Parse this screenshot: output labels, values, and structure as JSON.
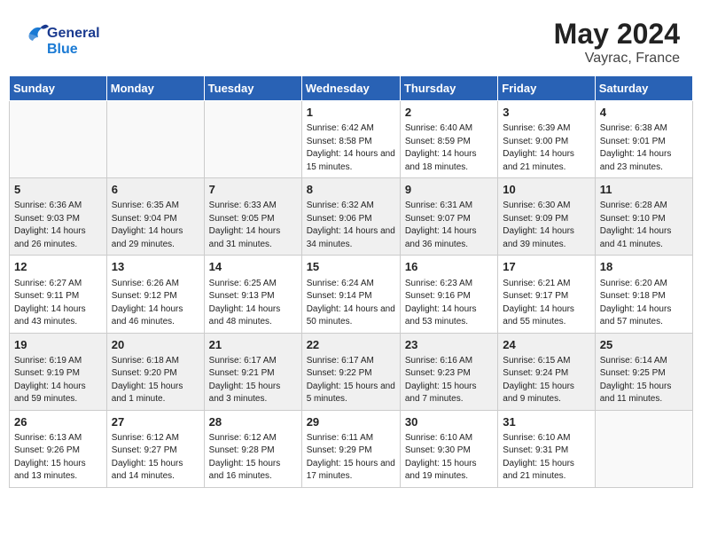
{
  "header": {
    "logo_general": "General",
    "logo_blue": "Blue",
    "month_year": "May 2024",
    "location": "Vayrac, France"
  },
  "days_of_week": [
    "Sunday",
    "Monday",
    "Tuesday",
    "Wednesday",
    "Thursday",
    "Friday",
    "Saturday"
  ],
  "weeks": [
    [
      {
        "day": "",
        "sunrise": "",
        "sunset": "",
        "daylight": ""
      },
      {
        "day": "",
        "sunrise": "",
        "sunset": "",
        "daylight": ""
      },
      {
        "day": "",
        "sunrise": "",
        "sunset": "",
        "daylight": ""
      },
      {
        "day": "1",
        "sunrise": "Sunrise: 6:42 AM",
        "sunset": "Sunset: 8:58 PM",
        "daylight": "Daylight: 14 hours and 15 minutes."
      },
      {
        "day": "2",
        "sunrise": "Sunrise: 6:40 AM",
        "sunset": "Sunset: 8:59 PM",
        "daylight": "Daylight: 14 hours and 18 minutes."
      },
      {
        "day": "3",
        "sunrise": "Sunrise: 6:39 AM",
        "sunset": "Sunset: 9:00 PM",
        "daylight": "Daylight: 14 hours and 21 minutes."
      },
      {
        "day": "4",
        "sunrise": "Sunrise: 6:38 AM",
        "sunset": "Sunset: 9:01 PM",
        "daylight": "Daylight: 14 hours and 23 minutes."
      }
    ],
    [
      {
        "day": "5",
        "sunrise": "Sunrise: 6:36 AM",
        "sunset": "Sunset: 9:03 PM",
        "daylight": "Daylight: 14 hours and 26 minutes."
      },
      {
        "day": "6",
        "sunrise": "Sunrise: 6:35 AM",
        "sunset": "Sunset: 9:04 PM",
        "daylight": "Daylight: 14 hours and 29 minutes."
      },
      {
        "day": "7",
        "sunrise": "Sunrise: 6:33 AM",
        "sunset": "Sunset: 9:05 PM",
        "daylight": "Daylight: 14 hours and 31 minutes."
      },
      {
        "day": "8",
        "sunrise": "Sunrise: 6:32 AM",
        "sunset": "Sunset: 9:06 PM",
        "daylight": "Daylight: 14 hours and 34 minutes."
      },
      {
        "day": "9",
        "sunrise": "Sunrise: 6:31 AM",
        "sunset": "Sunset: 9:07 PM",
        "daylight": "Daylight: 14 hours and 36 minutes."
      },
      {
        "day": "10",
        "sunrise": "Sunrise: 6:30 AM",
        "sunset": "Sunset: 9:09 PM",
        "daylight": "Daylight: 14 hours and 39 minutes."
      },
      {
        "day": "11",
        "sunrise": "Sunrise: 6:28 AM",
        "sunset": "Sunset: 9:10 PM",
        "daylight": "Daylight: 14 hours and 41 minutes."
      }
    ],
    [
      {
        "day": "12",
        "sunrise": "Sunrise: 6:27 AM",
        "sunset": "Sunset: 9:11 PM",
        "daylight": "Daylight: 14 hours and 43 minutes."
      },
      {
        "day": "13",
        "sunrise": "Sunrise: 6:26 AM",
        "sunset": "Sunset: 9:12 PM",
        "daylight": "Daylight: 14 hours and 46 minutes."
      },
      {
        "day": "14",
        "sunrise": "Sunrise: 6:25 AM",
        "sunset": "Sunset: 9:13 PM",
        "daylight": "Daylight: 14 hours and 48 minutes."
      },
      {
        "day": "15",
        "sunrise": "Sunrise: 6:24 AM",
        "sunset": "Sunset: 9:14 PM",
        "daylight": "Daylight: 14 hours and 50 minutes."
      },
      {
        "day": "16",
        "sunrise": "Sunrise: 6:23 AM",
        "sunset": "Sunset: 9:16 PM",
        "daylight": "Daylight: 14 hours and 53 minutes."
      },
      {
        "day": "17",
        "sunrise": "Sunrise: 6:21 AM",
        "sunset": "Sunset: 9:17 PM",
        "daylight": "Daylight: 14 hours and 55 minutes."
      },
      {
        "day": "18",
        "sunrise": "Sunrise: 6:20 AM",
        "sunset": "Sunset: 9:18 PM",
        "daylight": "Daylight: 14 hours and 57 minutes."
      }
    ],
    [
      {
        "day": "19",
        "sunrise": "Sunrise: 6:19 AM",
        "sunset": "Sunset: 9:19 PM",
        "daylight": "Daylight: 14 hours and 59 minutes."
      },
      {
        "day": "20",
        "sunrise": "Sunrise: 6:18 AM",
        "sunset": "Sunset: 9:20 PM",
        "daylight": "Daylight: 15 hours and 1 minute."
      },
      {
        "day": "21",
        "sunrise": "Sunrise: 6:17 AM",
        "sunset": "Sunset: 9:21 PM",
        "daylight": "Daylight: 15 hours and 3 minutes."
      },
      {
        "day": "22",
        "sunrise": "Sunrise: 6:17 AM",
        "sunset": "Sunset: 9:22 PM",
        "daylight": "Daylight: 15 hours and 5 minutes."
      },
      {
        "day": "23",
        "sunrise": "Sunrise: 6:16 AM",
        "sunset": "Sunset: 9:23 PM",
        "daylight": "Daylight: 15 hours and 7 minutes."
      },
      {
        "day": "24",
        "sunrise": "Sunrise: 6:15 AM",
        "sunset": "Sunset: 9:24 PM",
        "daylight": "Daylight: 15 hours and 9 minutes."
      },
      {
        "day": "25",
        "sunrise": "Sunrise: 6:14 AM",
        "sunset": "Sunset: 9:25 PM",
        "daylight": "Daylight: 15 hours and 11 minutes."
      }
    ],
    [
      {
        "day": "26",
        "sunrise": "Sunrise: 6:13 AM",
        "sunset": "Sunset: 9:26 PM",
        "daylight": "Daylight: 15 hours and 13 minutes."
      },
      {
        "day": "27",
        "sunrise": "Sunrise: 6:12 AM",
        "sunset": "Sunset: 9:27 PM",
        "daylight": "Daylight: 15 hours and 14 minutes."
      },
      {
        "day": "28",
        "sunrise": "Sunrise: 6:12 AM",
        "sunset": "Sunset: 9:28 PM",
        "daylight": "Daylight: 15 hours and 16 minutes."
      },
      {
        "day": "29",
        "sunrise": "Sunrise: 6:11 AM",
        "sunset": "Sunset: 9:29 PM",
        "daylight": "Daylight: 15 hours and 17 minutes."
      },
      {
        "day": "30",
        "sunrise": "Sunrise: 6:10 AM",
        "sunset": "Sunset: 9:30 PM",
        "daylight": "Daylight: 15 hours and 19 minutes."
      },
      {
        "day": "31",
        "sunrise": "Sunrise: 6:10 AM",
        "sunset": "Sunset: 9:31 PM",
        "daylight": "Daylight: 15 hours and 21 minutes."
      },
      {
        "day": "",
        "sunrise": "",
        "sunset": "",
        "daylight": ""
      }
    ]
  ]
}
